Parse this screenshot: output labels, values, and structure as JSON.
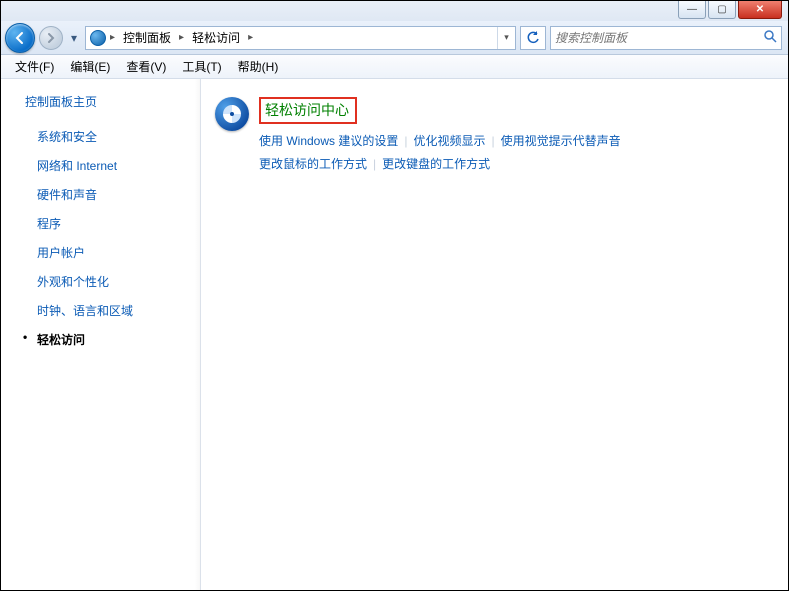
{
  "titlebar": {
    "min": "—",
    "max": "▢",
    "close": "✕"
  },
  "nav": {
    "segments": [
      "控制面板",
      "轻松访问"
    ],
    "search_placeholder": "搜索控制面板"
  },
  "menu": {
    "file": "文件(F)",
    "edit": "编辑(E)",
    "view": "查看(V)",
    "tools": "工具(T)",
    "help": "帮助(H)"
  },
  "sidebar": {
    "home": "控制面板主页",
    "items": [
      {
        "label": "系统和安全",
        "active": false
      },
      {
        "label": "网络和 Internet",
        "active": false
      },
      {
        "label": "硬件和声音",
        "active": false
      },
      {
        "label": "程序",
        "active": false
      },
      {
        "label": "用户帐户",
        "active": false
      },
      {
        "label": "外观和个性化",
        "active": false
      },
      {
        "label": "时钟、语言和区域",
        "active": false
      },
      {
        "label": "轻松访问",
        "active": true
      }
    ]
  },
  "content": {
    "title": "轻松访问中心",
    "links": [
      "使用 Windows 建议的设置",
      "优化视频显示",
      "使用视觉提示代替声音",
      "更改鼠标的工作方式",
      "更改键盘的工作方式"
    ]
  }
}
